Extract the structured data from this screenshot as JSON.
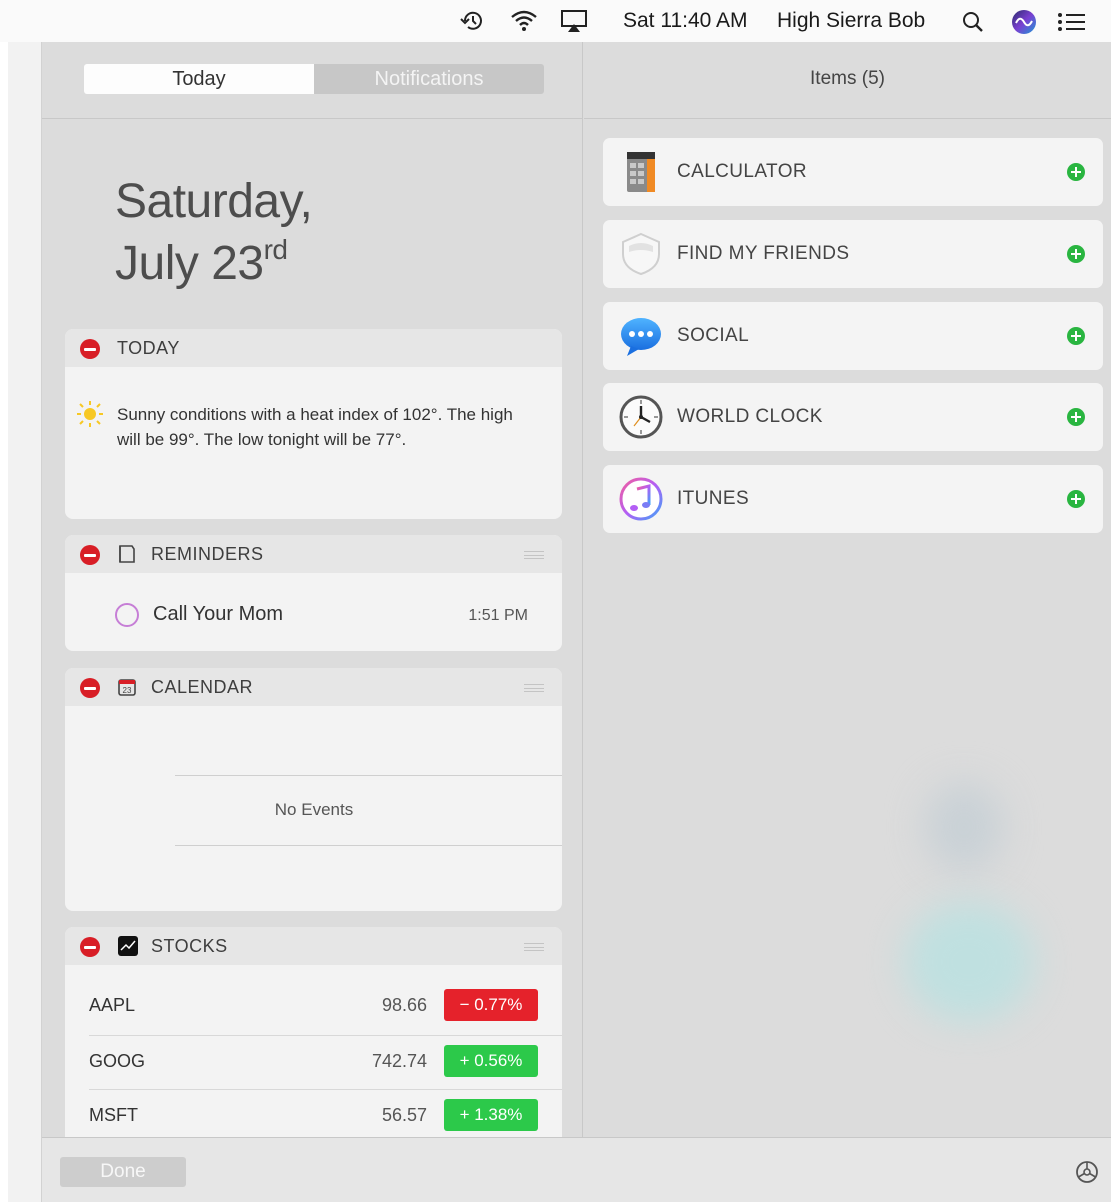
{
  "menubar": {
    "clock": "Sat 11:40 AM",
    "user": "High Sierra Bob",
    "icons": [
      "time-machine-icon",
      "wifi-icon",
      "airplay-icon",
      "spotlight-search-icon",
      "siri-icon",
      "notification-center-icon"
    ]
  },
  "segmented": {
    "today": "Today",
    "notifications": "Notifications"
  },
  "date": {
    "line1": "Saturday,",
    "line2_main": "July 23",
    "line2_suffix": "rd"
  },
  "widgets": {
    "today": {
      "title": "TODAY",
      "forecast": "Sunny conditions with a heat index of 102°. The high will be 99°. The low tonight will be 77°."
    },
    "reminders": {
      "title": "REMINDERS",
      "item": "Call Your Mom",
      "time": "1:51 PM"
    },
    "calendar": {
      "title": "CALENDAR",
      "empty": "No Events"
    },
    "stocks": {
      "title": "STOCKS",
      "rows": [
        {
          "symbol": "AAPL",
          "price": "98.66",
          "change": "− 0.77%",
          "color": "#e5222b"
        },
        {
          "symbol": "GOOG",
          "price": "742.74",
          "change": "+ 0.56%",
          "color": "#2cc94a"
        },
        {
          "symbol": "MSFT",
          "price": "56.57",
          "change": "+ 1.38%",
          "color": "#2cc94a"
        }
      ]
    }
  },
  "items_panel": {
    "count": "Items (5)",
    "items": [
      {
        "label": "CALCULATOR",
        "icon": "calculator-icon"
      },
      {
        "label": "FIND MY FRIENDS",
        "icon": "find-my-friends-icon"
      },
      {
        "label": "SOCIAL",
        "icon": "social-icon"
      },
      {
        "label": "WORLD CLOCK",
        "icon": "world-clock-icon"
      },
      {
        "label": "ITUNES",
        "icon": "itunes-icon"
      }
    ]
  },
  "footer": {
    "done": "Done",
    "settings_icon": "settings-icon"
  },
  "colors": {
    "minus": "#d81e26",
    "plus": "#29b540",
    "down": "#e5222b",
    "up": "#2cc94a"
  }
}
